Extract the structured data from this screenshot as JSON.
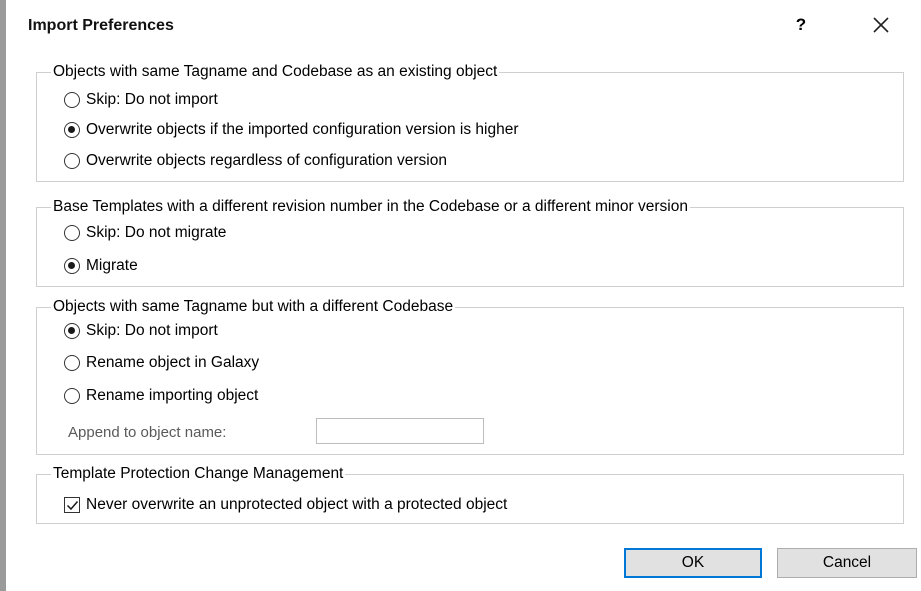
{
  "dialog": {
    "title": "Import Preferences",
    "help_label": "?",
    "close_icon": "close-icon"
  },
  "group1": {
    "legend": "Objects with same Tagname and Codebase as an existing object",
    "options": [
      {
        "label": "Skip: Do not import",
        "selected": false
      },
      {
        "label": "Overwrite objects if the imported configuration version is higher",
        "selected": true
      },
      {
        "label": "Overwrite objects regardless of configuration version",
        "selected": false
      }
    ]
  },
  "group2": {
    "legend": "Base Templates with a different revision number in the Codebase or a different minor version",
    "options": [
      {
        "label": "Skip: Do not migrate",
        "selected": false
      },
      {
        "label": "Migrate",
        "selected": true
      }
    ]
  },
  "group3": {
    "legend": "Objects with same Tagname but with a different Codebase",
    "options": [
      {
        "label": "Skip: Do not import",
        "selected": true
      },
      {
        "label": "Rename object in Galaxy",
        "selected": false
      },
      {
        "label": "Rename importing object",
        "selected": false
      }
    ],
    "append_label": "Append to object name:",
    "append_value": ""
  },
  "group4": {
    "legend": "Template Protection Change Management",
    "checkbox_label": "Never overwrite an unprotected object with a protected object",
    "checked": true
  },
  "buttons": {
    "ok": "OK",
    "cancel": "Cancel"
  },
  "colors": {
    "accent": "#0078d7",
    "group_border": "#cfcfcf",
    "button_bg": "#e1e1e1"
  }
}
